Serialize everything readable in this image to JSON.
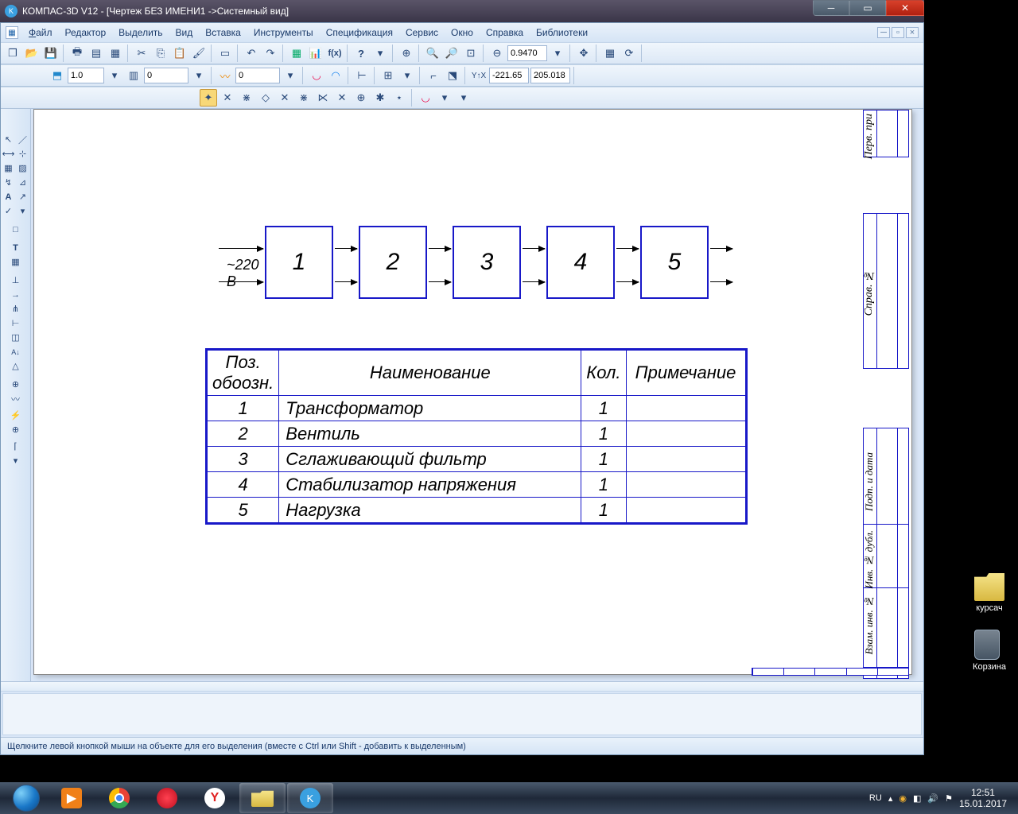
{
  "title": "КОМПАС-3D V12 - [Чертеж БЕЗ ИМЕНИ1 ->Системный вид]",
  "menu": {
    "file": "Файл",
    "editor": "Редактор",
    "select": "Выделить",
    "view": "Вид",
    "insert": "Вставка",
    "tools": "Инструменты",
    "spec": "Спецификация",
    "service": "Сервис",
    "window": "Окно",
    "help": "Справка",
    "libs": "Библиотеки"
  },
  "tb": {
    "zoom": "0.9470",
    "coordX": "-221.65",
    "coordY": "205.018",
    "scale": "1.0",
    "layer": "0",
    "line": "0"
  },
  "schematic": {
    "input": "~220 В",
    "boxes": [
      "1",
      "2",
      "3",
      "4",
      "5"
    ]
  },
  "table": {
    "headers": {
      "pos": "Поз. обоозн.",
      "name": "Наименование",
      "qty": "Кол.",
      "note": "Примечание"
    },
    "rows": [
      {
        "pos": "1",
        "name": "Трансформатор",
        "qty": "1",
        "note": ""
      },
      {
        "pos": "2",
        "name": "Вентиль",
        "qty": "1",
        "note": ""
      },
      {
        "pos": "3",
        "name": "Сглаживающий фильтр",
        "qty": "1",
        "note": ""
      },
      {
        "pos": "4",
        "name": "Стабилизатор напряжения",
        "qty": "1",
        "note": ""
      },
      {
        "pos": "5",
        "name": "Нагрузка",
        "qty": "1",
        "note": ""
      }
    ]
  },
  "stamp": {
    "perv": "Перв. при",
    "sprav": "Справ. №",
    "podp": "Подп. и дата",
    "inv": "Инв. № дубл.",
    "vzam": "Взам. инв. №"
  },
  "status": "Щелкните левой кнопкой мыши на объекте для его выделения (вместе с Ctrl или Shift - добавить к выделенным)",
  "desktop": {
    "kursach": "курсач",
    "bin": "Корзина"
  },
  "tray": {
    "lang": "RU",
    "time": "12:51",
    "date": "15.01.2017"
  }
}
